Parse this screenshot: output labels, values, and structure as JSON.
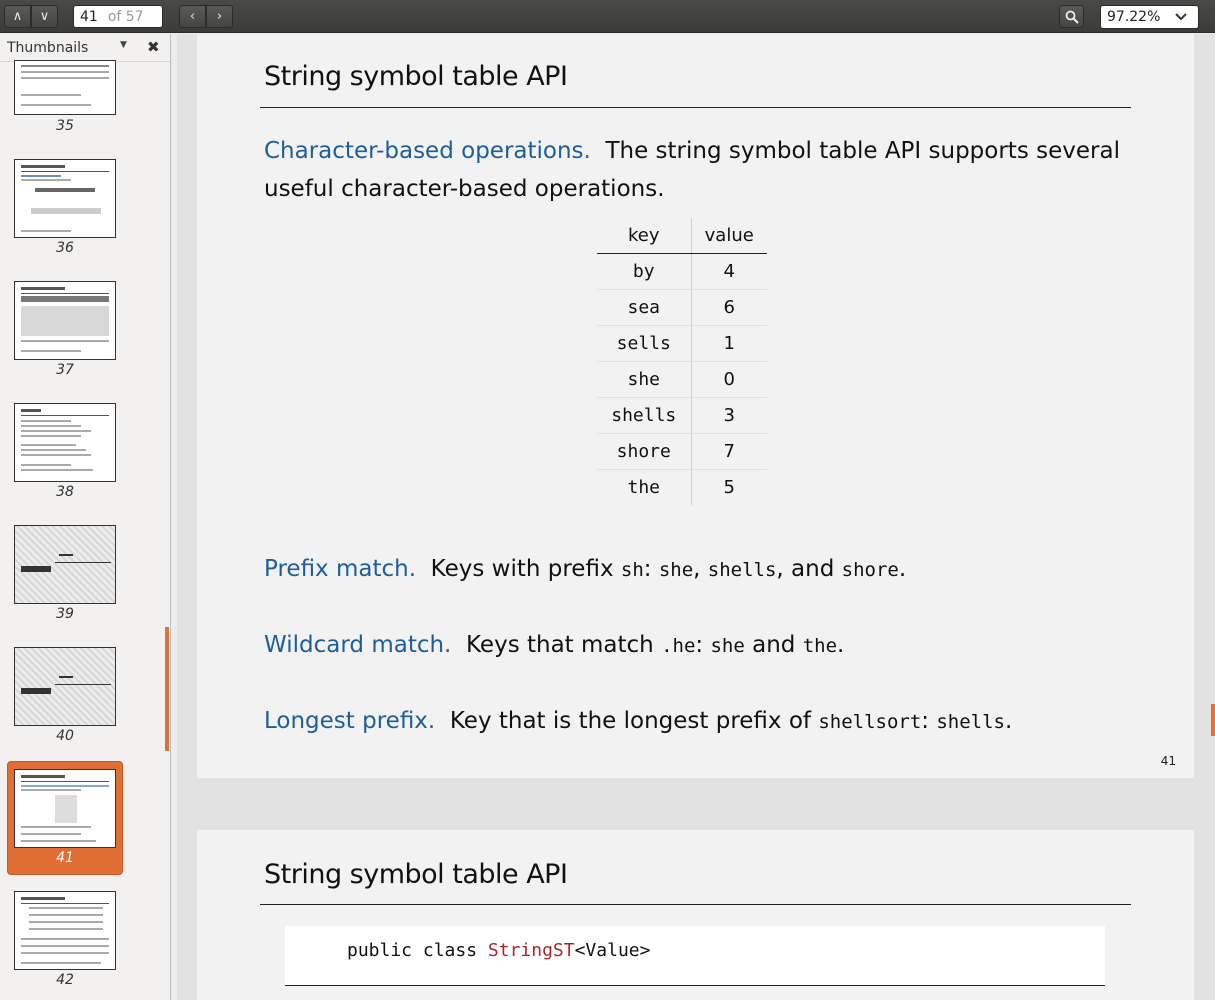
{
  "toolbar": {
    "page_current": "41",
    "page_total": "of 57",
    "zoom": "97.22%"
  },
  "sidebar": {
    "title": "Thumbnails",
    "thumbnails": [
      "35",
      "36",
      "37",
      "38",
      "39",
      "40",
      "41",
      "42"
    ],
    "selected": "41"
  },
  "page41": {
    "title": "String symbol table API",
    "intro_label": "Character-based operations.",
    "intro_text": "The string symbol table API supports several useful character-based operations.",
    "table": {
      "headers": [
        "key",
        "value"
      ],
      "rows": [
        [
          "by",
          "4"
        ],
        [
          "sea",
          "6"
        ],
        [
          "sells",
          "1"
        ],
        [
          "she",
          "0"
        ],
        [
          "shells",
          "3"
        ],
        [
          "shore",
          "7"
        ],
        [
          "the",
          "5"
        ]
      ]
    },
    "prefix": {
      "label": "Prefix match.",
      "text1": "Keys with prefix",
      "code1": "sh",
      "colon": ":",
      "k1": "she",
      "sep1": ",",
      "k2": "shells",
      "sep2": ", and",
      "k3": "shore",
      "end": "."
    },
    "wildcard": {
      "label": "Wildcard match.",
      "text1": "Keys that match",
      "code1": ".he",
      "colon": ":",
      "k1": "she",
      "and": "and",
      "k2": "the",
      "end": "."
    },
    "longest": {
      "label": "Longest prefix.",
      "text1": "Key that is the longest prefix of",
      "code1": "shellsort",
      "colon": ":",
      "k1": "shells",
      "end": "."
    },
    "page_number": "41"
  },
  "page42": {
    "title": "String symbol table API",
    "code_prefix": "public class ",
    "code_class": "StringST",
    "code_suffix": "<Value>"
  },
  "colors": {
    "accent": "#e06d34",
    "link_blue": "#1f5d99",
    "code_class": "#a52a2a"
  }
}
